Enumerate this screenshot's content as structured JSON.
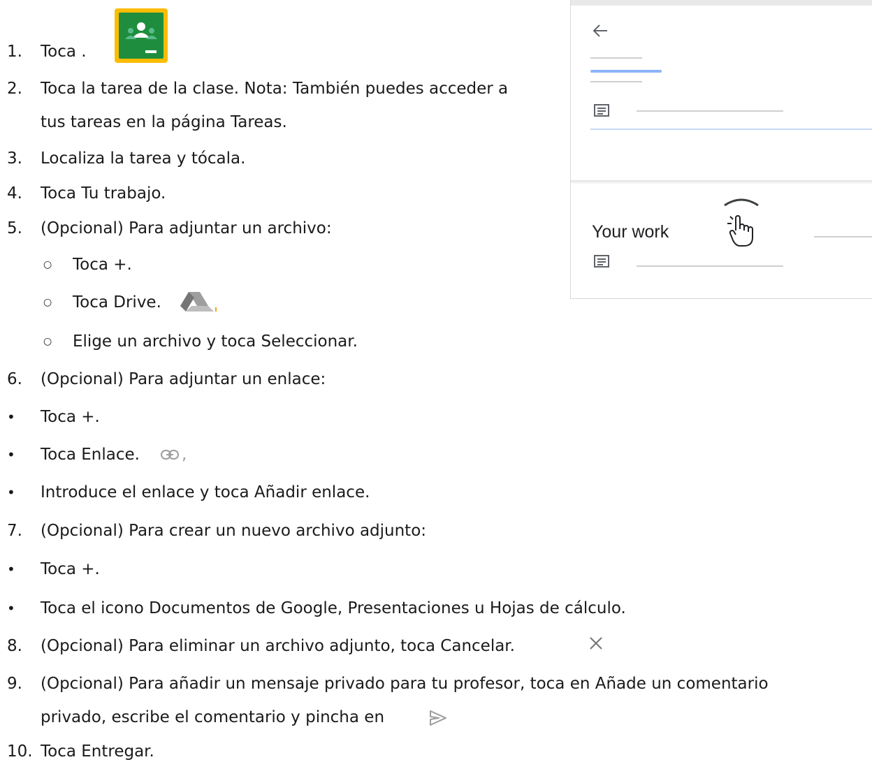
{
  "steps": {
    "s1": {
      "num": "1.",
      "text": "Toca ."
    },
    "s2": {
      "num": "2.",
      "text": "Toca la tarea de la clase. Nota: También puedes acceder a",
      "cont": "tus tareas en la página Tareas."
    },
    "s3": {
      "num": "3.",
      "text": "Localiza la tarea y tócala."
    },
    "s4": {
      "num": "4.",
      "text": "Toca Tu trabajo."
    },
    "s5": {
      "num": "5.",
      "text": "(Opcional) Para adjuntar un archivo:"
    },
    "s5a": {
      "bullet": "○",
      "text": "Toca +."
    },
    "s5b": {
      "bullet": "○",
      "text": "Toca Drive."
    },
    "s5c": {
      "bullet": "○",
      "text": "Elige un archivo y toca Seleccionar."
    },
    "s6": {
      "num": "6.",
      "text": "(Opcional) Para adjuntar un enlace:"
    },
    "s6a": {
      "bullet": "•",
      "text": "Toca +."
    },
    "s6b": {
      "bullet": "•",
      "text": "Toca Enlace.",
      "after": ","
    },
    "s6c": {
      "bullet": "•",
      "text": "Introduce el enlace y toca Añadir enlace."
    },
    "s7": {
      "num": "7.",
      "text": "(Opcional) Para crear un nuevo archivo adjunto:"
    },
    "s7a": {
      "bullet": "•",
      "text": "Toca +."
    },
    "s7b": {
      "bullet": "•",
      "text": "Toca el icono Documentos de Google, Presentaciones u Hojas de cálculo."
    },
    "s8": {
      "num": "8.",
      "text": "(Opcional) Para eliminar un archivo adjunto, toca Cancelar."
    },
    "s9": {
      "num": "9.",
      "text": "(Opcional) Para añadir un mensaje privado para tu profesor, toca en Añade un comentario",
      "cont": "privado, escribe el comentario y pincha en"
    },
    "s10": {
      "num": "10.",
      "text": "Toca Entregar."
    }
  },
  "panel": {
    "section_title": "Your work"
  },
  "icons": {
    "classroom": "google-classroom-icon",
    "drive": "google-drive-icon",
    "link": "link-icon",
    "close": "close-icon",
    "send": "send-icon",
    "back": "back-arrow-icon",
    "comment": "comment-icon",
    "hand": "hand-pointer-icon"
  },
  "colors": {
    "classroom_bg": "#fbbc04",
    "classroom_green": "#1e8e3e",
    "accent_blue": "#8ab4f8"
  }
}
